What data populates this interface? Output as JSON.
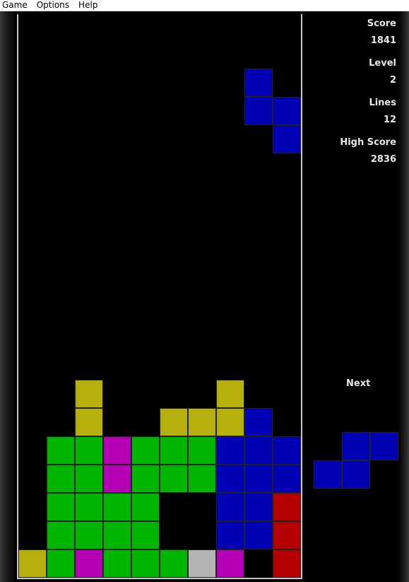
{
  "menu": {
    "items": [
      {
        "label": "Game"
      },
      {
        "label": "Options"
      },
      {
        "label": "Help"
      }
    ]
  },
  "stats": {
    "score_label": "Score",
    "score_value": "1841",
    "level_label": "Level",
    "level_value": "2",
    "lines_label": "Lines",
    "lines_value": "12",
    "high_score_label": "High Score",
    "high_score_value": "2836"
  },
  "next": {
    "label": "Next",
    "color": "blue",
    "shape": [
      [
        1,
        0
      ],
      [
        2,
        0
      ],
      [
        0,
        1
      ],
      [
        1,
        1
      ]
    ]
  },
  "colors": {
    "Y": "#b5b00b",
    "G": "#00b400",
    "M": "#b400b4",
    "B": "#0000b4",
    "R": "#b40000",
    "W": "#b4b4b4",
    "blue": "#0000b4"
  },
  "board": {
    "columns": 10,
    "rows": 20,
    "active_piece": {
      "color": "B",
      "cells": [
        [
          8,
          2
        ],
        [
          8,
          3
        ],
        [
          9,
          3
        ],
        [
          9,
          4
        ]
      ]
    },
    "grid": [
      "..........",
      "..........",
      "..........",
      "..........",
      "..........",
      "..........",
      "..........",
      "..........",
      "..........",
      "..........",
      "..........",
      "..........",
      "..........",
      "..Y....Y..",
      "..Y..YYYB.",
      ".GGMGGGBBB",
      ".GGMGGGBBB",
      ".GGGG..BBR",
      ".GGGG..BBR",
      "YGMGGGWM.R"
    ]
  }
}
